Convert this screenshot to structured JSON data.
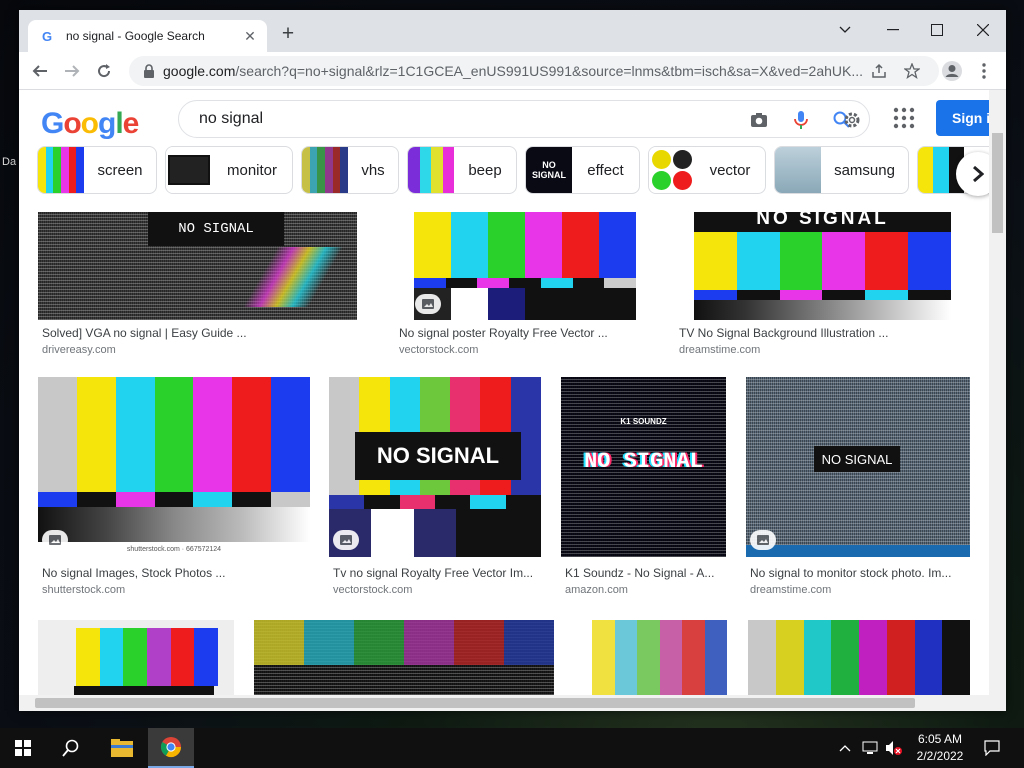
{
  "tab": {
    "title": "no signal - Google Search"
  },
  "omnibox": {
    "host": "google.com",
    "path": "/search?q=no+signal&rlz=1C1GCEA_enUS991US991&source=lnms&tbm=isch&sa=X&ved=2ahUK..."
  },
  "search": {
    "query": "no signal"
  },
  "header": {
    "sign_in": "Sign in",
    "logo": "Google"
  },
  "chips": [
    {
      "label": "screen"
    },
    {
      "label": "monitor"
    },
    {
      "label": "vhs"
    },
    {
      "label": "beep"
    },
    {
      "label": "effect"
    },
    {
      "label": "vector"
    },
    {
      "label": "samsung"
    }
  ],
  "results_row1": [
    {
      "caption": "Solved] VGA no signal | Easy Guide ...",
      "source": "drivereasy.com",
      "image_text": "NO SIGNAL"
    },
    {
      "caption": "No signal poster Royalty Free Vector ...",
      "source": "vectorstock.com"
    },
    {
      "caption": "TV No Signal Background Illustration ...",
      "source": "dreamstime.com",
      "image_text": "NO SIGNAL"
    }
  ],
  "results_row2": [
    {
      "caption": "No signal Images, Stock Photos ...",
      "source": "shutterstock.com",
      "image_text": "shutterstock.com · 667572124"
    },
    {
      "caption": "Tv no signal Royalty Free Vector Im...",
      "source": "vectorstock.com",
      "image_text": "NO SIGNAL"
    },
    {
      "caption": "K1 Soundz - No Signal - A...",
      "source": "amazon.com",
      "image_text": "NO SIGNAL",
      "image_subtext": "K1 SOUNDZ"
    },
    {
      "caption": "No signal to monitor stock photo. Im...",
      "source": "dreamstime.com",
      "image_text": "NO SIGNAL"
    }
  ],
  "taskbar": {
    "time": "6:05 AM",
    "date": "2/2/2022"
  },
  "desktop": {
    "icon_label_1": "Da"
  },
  "colors": {
    "accent": "#1a73e8",
    "bar_yellow": "#f5e50a",
    "bar_cyan": "#22d3f0",
    "bar_green": "#2bd12b",
    "bar_magenta": "#e835e8",
    "bar_red": "#ee1c1c",
    "bar_blue": "#1c3cf0"
  },
  "icons": [
    "google-favicon",
    "close-icon",
    "plus-icon",
    "minimize-icon",
    "maximize-icon",
    "back-icon",
    "forward-icon",
    "reload-icon",
    "lock-icon",
    "share-icon",
    "star-icon",
    "profile-icon",
    "menu-icon",
    "camera-icon",
    "mic-icon",
    "search-icon",
    "settings-icon",
    "apps-icon",
    "chevron-right-icon",
    "image-icon",
    "windows-icon",
    "search-taskbar-icon",
    "folder-icon",
    "chrome-icon",
    "chevron-up-icon",
    "network-icon",
    "volume-muted-icon",
    "notification-icon"
  ]
}
